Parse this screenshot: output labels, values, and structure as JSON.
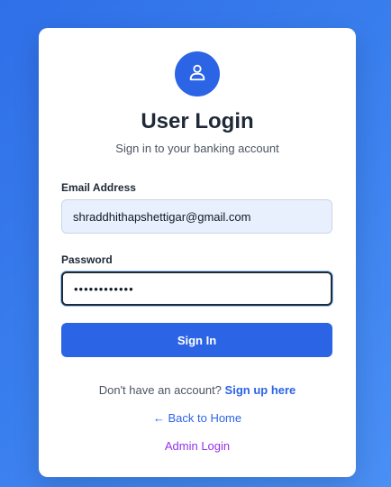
{
  "header": {
    "avatar_icon": "user-icon",
    "title": "User Login",
    "subtitle": "Sign in to your banking account"
  },
  "form": {
    "email_label": "Email Address",
    "email_value": "shraddhithapshettigar@gmail.com",
    "password_label": "Password",
    "password_value": "••••••••••••",
    "submit_label": "Sign In"
  },
  "footer": {
    "signup_prompt": "Don't have an account?",
    "signup_link": "Sign up here",
    "back_link": "← Back to Home",
    "admin_link": "Admin Login"
  },
  "colors": {
    "primary": "#2c64e6",
    "admin_link": "#9333ea",
    "background_start": "#2f6fe8",
    "background_end": "#4a8ff5"
  }
}
